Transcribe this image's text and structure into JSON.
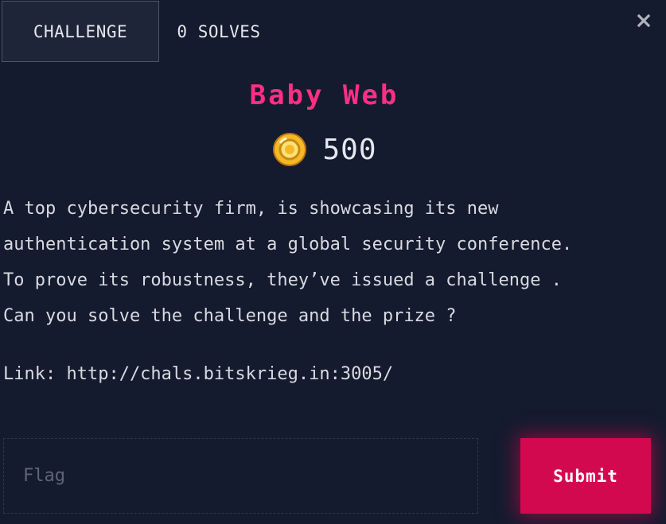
{
  "tabs": {
    "challenge_label": "CHALLENGE",
    "solves_label": "0 SOLVES"
  },
  "challenge": {
    "title": "Baby Web",
    "value": "500",
    "description_lines": [
      "A top cybersecurity firm, is showcasing its new",
      "authentication system at a global security conference.",
      "To prove its robustness, they’ve issued a challenge .",
      "Can you solve the challenge and the prize ?"
    ],
    "link_text": "Link: http://chals.bitskrieg.in:3005/"
  },
  "form": {
    "flag_placeholder": "Flag",
    "flag_value": "",
    "submit_label": "Submit"
  },
  "icons": {
    "close": "close-icon",
    "coin": "coin-icon"
  },
  "colors": {
    "background": "#151b2e",
    "title": "#ff2f85",
    "submit": "#d3094f",
    "coin": "#f5b928"
  }
}
